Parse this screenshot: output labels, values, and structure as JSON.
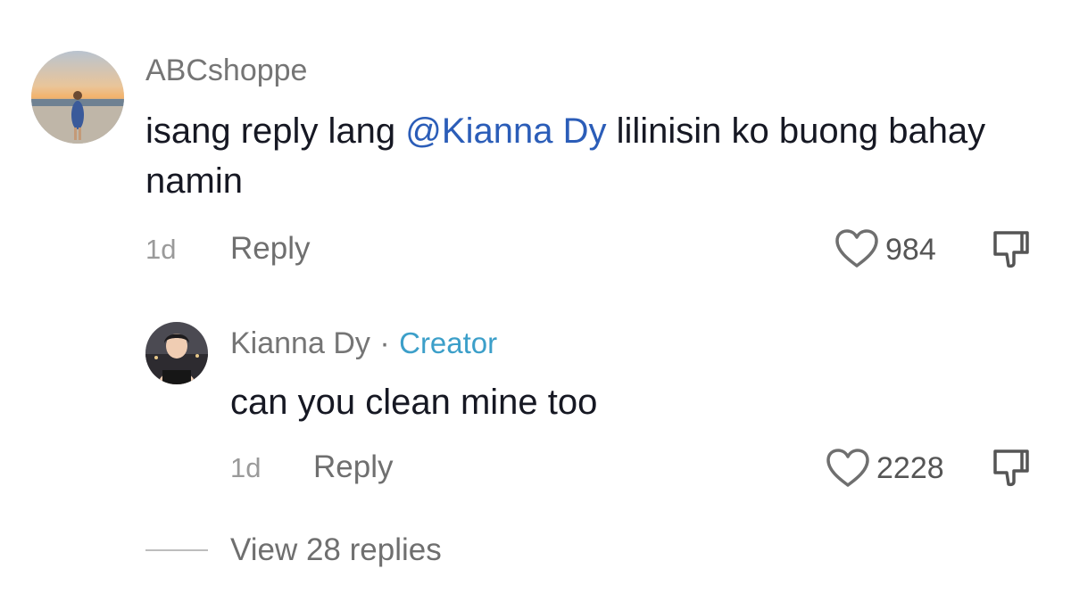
{
  "comment": {
    "username": "ABCshoppe",
    "text_before": "isang reply lang ",
    "mention": "@Kianna Dy",
    "text_after": " lilinisin ko buong bahay namin",
    "time": "1d",
    "reply_label": "Reply",
    "likes": "984",
    "icons": {
      "like": "heart-outline-icon",
      "dislike": "thumbs-down-icon"
    }
  },
  "reply": {
    "username": "Kianna Dy",
    "separator": "·",
    "badge": "Creator",
    "text": "can you clean mine too",
    "time": "1d",
    "reply_label": "Reply",
    "likes": "2228",
    "icons": {
      "like": "heart-outline-icon",
      "dislike": "thumbs-down-icon"
    }
  },
  "view_replies_label": "View 28 replies",
  "colors": {
    "mention": "#2b5db8",
    "creator_badge": "#3c9fc9",
    "username": "#757575",
    "text": "#161823"
  }
}
